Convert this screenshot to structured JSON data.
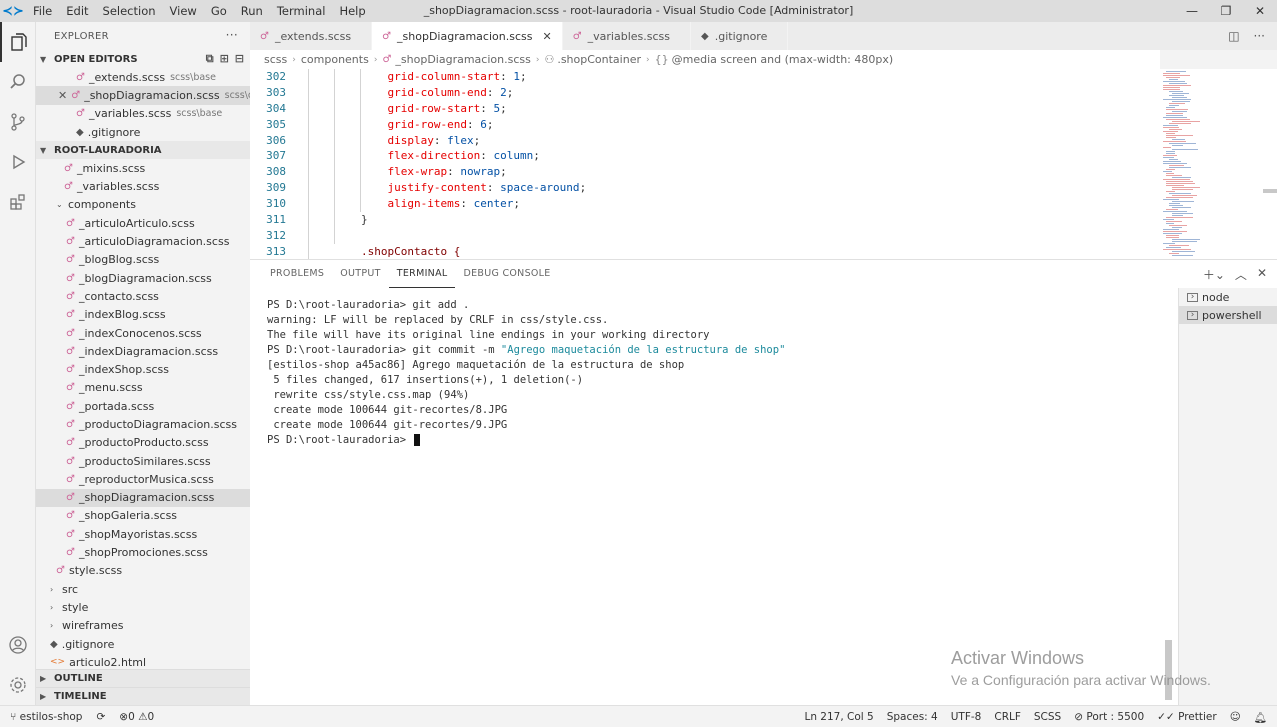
{
  "titlebar": {
    "menu": [
      "File",
      "Edit",
      "Selection",
      "View",
      "Go",
      "Run",
      "Terminal",
      "Help"
    ],
    "title": "_shopDiagramacion.scss - root-lauradoria - Visual Studio Code [Administrator]",
    "minimize": "—",
    "restore": "❐",
    "close": "✕"
  },
  "sidebar": {
    "header": "EXPLORER",
    "more": "···",
    "open_editors_title": "OPEN EDITORS",
    "open_editors": [
      {
        "name": "_extends.scss",
        "desc": "scss\\base"
      },
      {
        "name": "_shopDiagramacion.scss",
        "desc": "scss\\co..."
      },
      {
        "name": "_variables.scss",
        "desc": "scss\\base"
      },
      {
        "name": ".gitignore",
        "desc": ""
      }
    ],
    "root_title": "ROOT-LAURADORIA",
    "root_items": [
      {
        "name": "_mixins.scss"
      },
      {
        "name": "_variables.scss"
      }
    ],
    "components_folder": "components",
    "components": [
      "_articuloArticulo.scss",
      "_articuloDiagramacion.scss",
      "_blogBlog.scss",
      "_blogDiagramacion.scss",
      "_contacto.scss",
      "_indexBlog.scss",
      "_indexConocenos.scss",
      "_indexDiagramacion.scss",
      "_indexShop.scss",
      "_menu.scss",
      "_portada.scss",
      "_productoDiagramacion.scss",
      "_productoProducto.scss",
      "_productoSimilares.scss",
      "_reproductorMusica.scss",
      "_shopDiagramacion.scss",
      "_shopGaleria.scss",
      "_shopMayoristas.scss",
      "_shopPromociones.scss"
    ],
    "style_scss": "style.scss",
    "folders": [
      "src",
      "style",
      "wireframes"
    ],
    "gitignore": ".gitignore",
    "articulo_html": "articulo2.html",
    "outline": "OUTLINE",
    "timeline": "TIMELINE"
  },
  "tabs": [
    {
      "name": "_extends.scss",
      "icon": "sass",
      "active": false
    },
    {
      "name": "_shopDiagramacion.scss",
      "icon": "sass",
      "active": true
    },
    {
      "name": "_variables.scss",
      "icon": "sass",
      "active": false
    },
    {
      "name": ".gitignore",
      "icon": "git",
      "active": false
    }
  ],
  "breadcrumb": [
    "scss",
    "components",
    "_shopDiagramacion.scss",
    ".shopContainer",
    "@media screen and (max-width: 480px)"
  ],
  "editor": {
    "lines": [
      {
        "n": "302",
        "prop": "grid-column-start",
        "val": "1"
      },
      {
        "n": "303",
        "prop": "grid-column-end",
        "val": "2"
      },
      {
        "n": "304",
        "prop": "grid-row-start",
        "val": "5"
      },
      {
        "n": "305",
        "prop": "grid-row-end",
        "val": "6"
      },
      {
        "n": "306",
        "prop": "display",
        "val": "flex"
      },
      {
        "n": "307",
        "prop": "flex-direction",
        "val": "column"
      },
      {
        "n": "308",
        "prop": "flex-wrap",
        "val": "nowrap"
      },
      {
        "n": "309",
        "prop": "justify-content",
        "val": "space-around"
      },
      {
        "n": "310",
        "prop": "align-items",
        "val": "center"
      }
    ],
    "line311": {
      "n": "311",
      "text": "}"
    },
    "line312": {
      "n": "312",
      "text": ""
    },
    "line313": {
      "n": "313",
      "text": ".shopContacto {"
    }
  },
  "panel": {
    "tabs": [
      "PROBLEMS",
      "OUTPUT",
      "TERMINAL",
      "DEBUG CONSOLE"
    ],
    "active_tab": "TERMINAL",
    "terminal": {
      "l1_prompt": "PS D:\\root-lauradoria> ",
      "l1_cmd": "git add .",
      "l2": "warning: LF will be replaced by CRLF in css/style.css.",
      "l3": "The file will have its original line endings in your working directory",
      "l4_prompt": "PS D:\\root-lauradoria> ",
      "l4_cmd": "git commit -m ",
      "l4_str": "\"Agrego maquetación de la estructura de shop\"",
      "l5": "[estilos-shop a45ac86] Agrego maquetación de la estructura de shop",
      "l6": " 5 files changed, 617 insertions(+), 1 deletion(-)",
      "l7": " rewrite css/style.css.map (94%)",
      "l8": " create mode 100644 git-recortes/8.JPG",
      "l9": " create mode 100644 git-recortes/9.JPG",
      "l10_prompt": "PS D:\\root-lauradoria> "
    },
    "terminals": [
      "node",
      "powershell"
    ]
  },
  "watermark": {
    "line1": "Activar Windows",
    "line2": "Ve a Configuración para activar Windows."
  },
  "statusbar": {
    "branch": "estilos-shop",
    "errors": "0",
    "warnings": "0",
    "position": "Ln 217, Col 5",
    "spaces": "Spaces: 4",
    "encoding": "UTF-8",
    "eol": "CRLF",
    "language": "SCSS",
    "port": "Port : 5500",
    "prettier": "Prettier"
  }
}
